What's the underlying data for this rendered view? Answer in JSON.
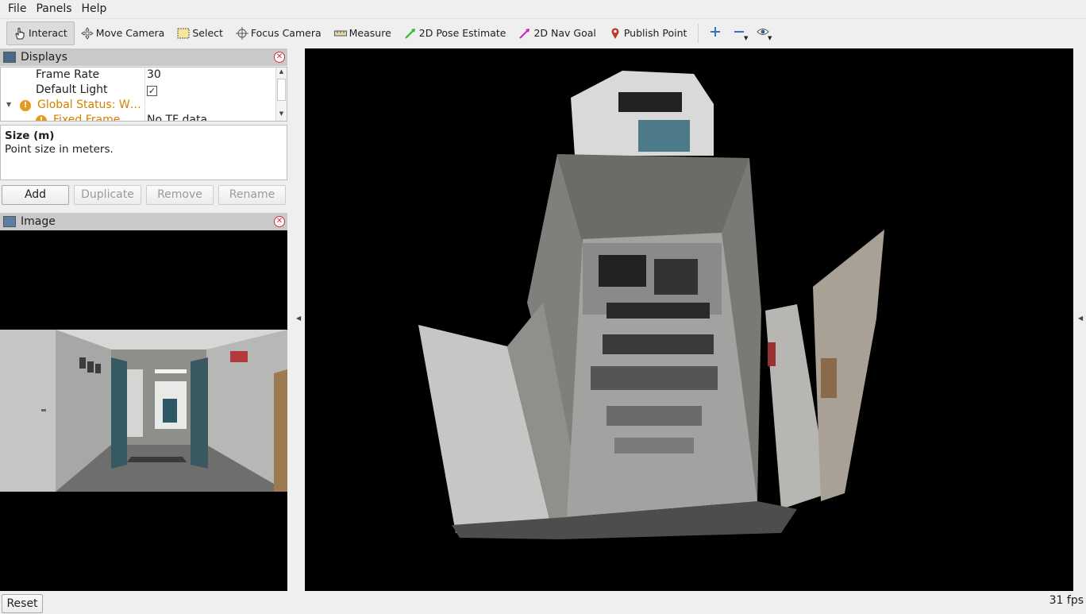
{
  "menu": {
    "items": [
      {
        "label": "File"
      },
      {
        "label": "Panels"
      },
      {
        "label": "Help"
      }
    ]
  },
  "toolbar": {
    "tools": [
      {
        "label": "Interact",
        "icon": "hand-pointer-icon",
        "active": true
      },
      {
        "label": "Move Camera",
        "icon": "move-camera-icon"
      },
      {
        "label": "Select",
        "icon": "select-box-icon"
      },
      {
        "label": "Focus Camera",
        "icon": "focus-crosshair-icon"
      },
      {
        "label": "Measure",
        "icon": "ruler-icon"
      },
      {
        "label": "2D Pose Estimate",
        "icon": "green-arrow-icon"
      },
      {
        "label": "2D Nav Goal",
        "icon": "magenta-arrow-icon"
      },
      {
        "label": "Publish Point",
        "icon": "map-pin-icon"
      }
    ]
  },
  "displays_panel": {
    "title": "Displays",
    "rows": [
      {
        "name": "Frame Rate",
        "value": "30"
      },
      {
        "name": "Default Light",
        "value": "✓"
      },
      {
        "name": "Global Status: W…",
        "value": "",
        "status": "warning"
      },
      {
        "name": "Fixed Frame",
        "value": "No TF data",
        "status": "warning"
      }
    ]
  },
  "description": {
    "title": "Size (m)",
    "text": "Point size in meters."
  },
  "buttons": {
    "add": "Add",
    "duplicate": "Duplicate",
    "remove": "Remove",
    "rename": "Rename"
  },
  "image_panel": {
    "title": "Image"
  },
  "status": {
    "reset": "Reset",
    "fps": "31 fps"
  },
  "colors": {
    "accent_warning": "#e39a1e",
    "warning_text": "#d47f00",
    "panel_header": "#c9c9c9",
    "view_background": "#000000"
  }
}
